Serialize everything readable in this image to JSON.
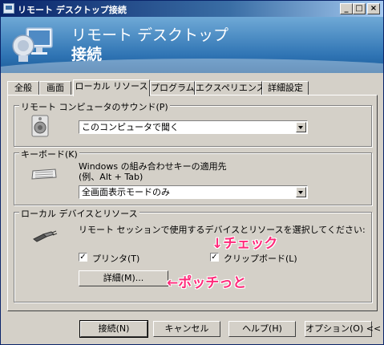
{
  "window": {
    "title": "リモート デスクトップ接続",
    "controls": {
      "minimize": "_",
      "maximize": "□",
      "close": "×"
    }
  },
  "banner": {
    "subtitle": "リモート デスクトップ",
    "title": "接続"
  },
  "tabs": [
    "全般",
    "画面",
    "ローカル リソース",
    "プログラム",
    "エクスペリエンス",
    "詳細設定"
  ],
  "active_tab": "ローカル リソース",
  "sound": {
    "legend": "リモート コンピュータのサウンド(P)",
    "icon": "speaker-icon",
    "selected": "このコンピュータで聞く"
  },
  "keyboard": {
    "legend": "キーボード(K)",
    "icon": "keyboard-icon",
    "description_line1": "Windows の組み合わせキーの適用先",
    "description_line2": "(例、Alt + Tab)",
    "selected": "全画面表示モードのみ"
  },
  "local_devices": {
    "legend": "ローカル デバイスとリソース",
    "icon": "plug-icon",
    "description": "リモート セッションで使用するデバイスとリソースを選択してください:",
    "printers": {
      "label": "プリンタ(T)",
      "checked": true
    },
    "clipboard": {
      "label": "クリップボード(L)",
      "checked": true
    },
    "details_button": "詳細(M)..."
  },
  "annotations": {
    "check": "↓チェック",
    "click": "←ポッチっと",
    "color": "#ff2a7a"
  },
  "footer": {
    "connect": "接続(N)",
    "cancel": "キャンセル",
    "help": "ヘルプ(H)",
    "options": "オプション(O) <<"
  }
}
